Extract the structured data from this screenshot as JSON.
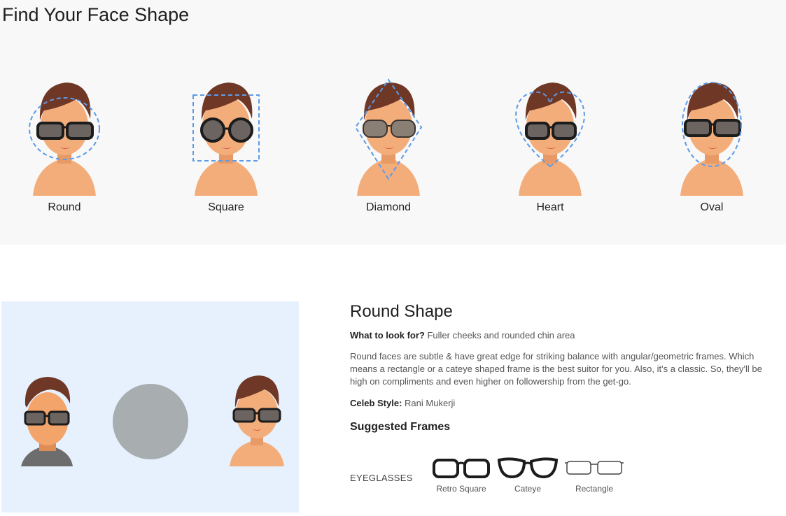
{
  "page": {
    "title": "Find Your Face Shape"
  },
  "colors": {
    "hair": "#6e3726",
    "skin": "#f3ad7a",
    "dash": "#5b9be8",
    "panel_bg": "#e6f1fd",
    "circle": "#a8adb0"
  },
  "face_shapes": [
    {
      "label": "Round",
      "icon": "round-face-icon"
    },
    {
      "label": "Square",
      "icon": "square-face-icon"
    },
    {
      "label": "Diamond",
      "icon": "diamond-face-icon"
    },
    {
      "label": "Heart",
      "icon": "heart-face-icon"
    },
    {
      "label": "Oval",
      "icon": "oval-face-icon"
    }
  ],
  "detail": {
    "title": "Round Shape",
    "look_label": "What to look for?",
    "look_text": " Fuller cheeks and rounded chin area",
    "description": "Round faces are subtle & have great edge for striking balance with angular/geometric frames. Which means a rectangle or a cateye shaped frame is the best suitor for you. Also, it's a classic. So, they'll be high on compliments and even higher on followership from the get-go.",
    "celeb_label": "Celeb Style:",
    "celeb_text": " Rani Mukerji",
    "suggested_title": "Suggested Frames",
    "category": "EYEGLASSES",
    "frames": [
      {
        "label": "Retro Square",
        "icon": "retro-square-frame-icon"
      },
      {
        "label": "Cateye",
        "icon": "cateye-frame-icon"
      },
      {
        "label": "Rectangle",
        "icon": "rectangle-frame-icon"
      }
    ]
  }
}
